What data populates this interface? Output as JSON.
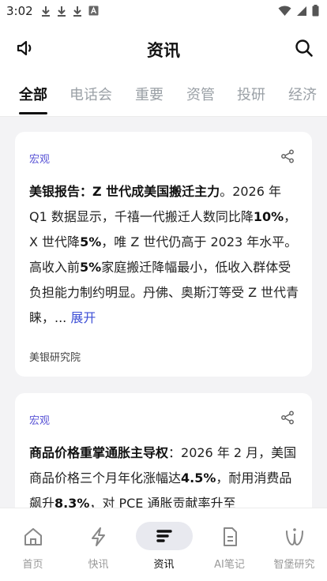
{
  "status_bar": {
    "time": "3:02"
  },
  "appbar": {
    "title": "资讯"
  },
  "tabs": [
    {
      "label": "全部",
      "active": true
    },
    {
      "label": "电话会",
      "active": false
    },
    {
      "label": "重要",
      "active": false
    },
    {
      "label": "资管",
      "active": false
    },
    {
      "label": "投研",
      "active": false
    },
    {
      "label": "经济",
      "active": false
    }
  ],
  "cards": [
    {
      "category": "宏观",
      "headline": "美银报告：Z 世代成美国搬迁主力",
      "body_1": "。2026 年 Q1 数据显示，千禧一代搬迁人数同比降",
      "bold_1": "10%",
      "body_2": "，X 世代降",
      "bold_2": "5%",
      "body_3": "，唯 Z 世代仍高于 2023 年水平。高收入前",
      "bold_3": "5%",
      "body_4": "家庭搬迁降幅最小，低收入群体受负担能力制约明显。丹佛、奥斯汀等受 Z 世代青睐，... ",
      "expand_label": "展开",
      "source": "美银研究院"
    },
    {
      "category": "宏观",
      "headline": "商品价格重掌通胀主导权",
      "body_1": "：2026 年 2 月，美国商品价格三个月年化涨幅达",
      "bold_1": "4.5%",
      "body_2": "，耐用消费品飙升",
      "bold_2": "8.3%",
      "body_3": "，对 PCE 通胀贡献率升至"
    }
  ],
  "bottom_nav": [
    {
      "label": "首页",
      "icon": "home-icon",
      "active": false
    },
    {
      "label": "快讯",
      "icon": "lightning-icon",
      "active": false
    },
    {
      "label": "资讯",
      "icon": "news-icon",
      "active": true
    },
    {
      "label": "AI笔记",
      "icon": "note-icon",
      "active": false
    },
    {
      "label": "智堡研究",
      "icon": "research-icon",
      "active": false
    }
  ]
}
